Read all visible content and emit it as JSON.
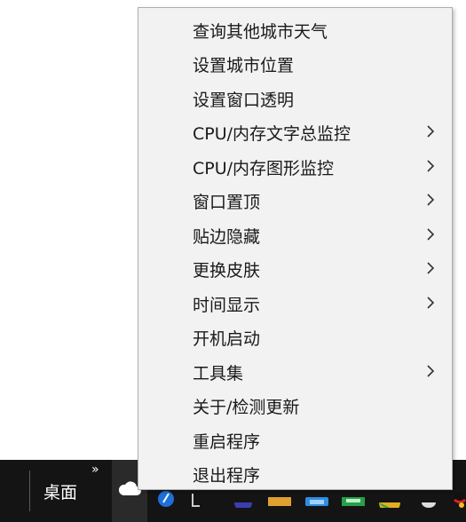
{
  "menu": {
    "items": [
      {
        "label": "查询其他城市天气",
        "submenu": false
      },
      {
        "label": "设置城市位置",
        "submenu": false
      },
      {
        "label": "设置窗口透明",
        "submenu": false
      },
      {
        "label": "CPU/内存文字总监控",
        "submenu": true
      },
      {
        "label": "CPU/内存图形监控",
        "submenu": true
      },
      {
        "label": "窗口置顶",
        "submenu": true
      },
      {
        "label": "贴边隐藏",
        "submenu": true
      },
      {
        "label": "更换皮肤",
        "submenu": true
      },
      {
        "label": "时间显示",
        "submenu": true
      },
      {
        "label": "开机启动",
        "submenu": false
      },
      {
        "label": "工具集",
        "submenu": true
      },
      {
        "label": "关于/检测更新",
        "submenu": false
      },
      {
        "label": "重启程序",
        "submenu": false
      },
      {
        "label": "退出程序",
        "submenu": false
      }
    ]
  },
  "taskbar": {
    "desktop_label": "桌面",
    "overflow_icon": "double-chevron-icon",
    "colors": {
      "background": "#141414",
      "text": "#ffffff"
    }
  }
}
